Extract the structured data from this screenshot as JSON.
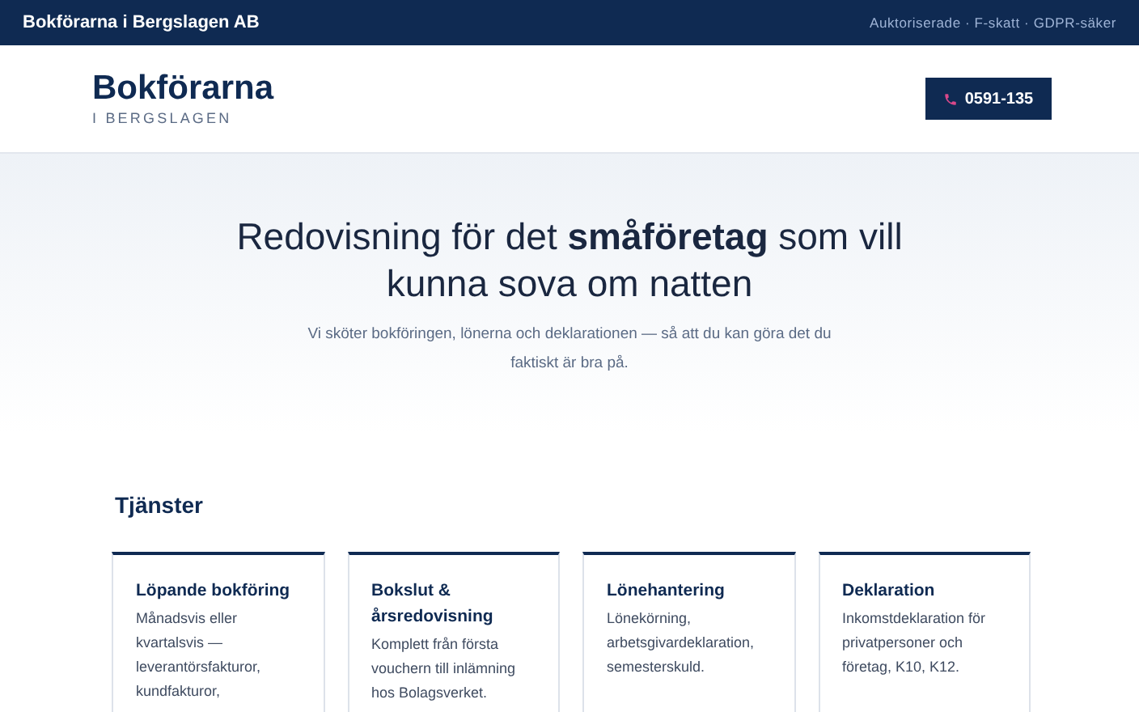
{
  "top_bar": {
    "company": "Bokförarna i Bergslagen AB",
    "badges": "Auktoriserade · F-skatt · GDPR-säker"
  },
  "header": {
    "brand": "Bokförarna",
    "tagline": "I BERGSLAGEN",
    "phone_button": "0591-135"
  },
  "hero": {
    "heading": "Redovisning för det **småföretag** som vill kunna sova om natten",
    "lead": "Vi sköter bokföringen, lönerna och deklarationen — så att du kan göra det du faktiskt är bra på."
  },
  "services": {
    "title": "Tjänster",
    "cards": [
      {
        "title": "Löpande bokföring",
        "text": "Månadsvis eller kvartalsvis — leverantörsfakturor, kundfakturor,"
      },
      {
        "title": "Bokslut & årsredovisning",
        "text": "Komplett från första vouchern till inlämning hos Bolagsverket."
      },
      {
        "title": "Lönehantering",
        "text": "Lönekörning, arbetsgivardeklaration, semesterskuld."
      },
      {
        "title": "Deklaration",
        "text": "Inkomstdeklaration för privatpersoner och företag, K10, K12."
      }
    ]
  }
}
